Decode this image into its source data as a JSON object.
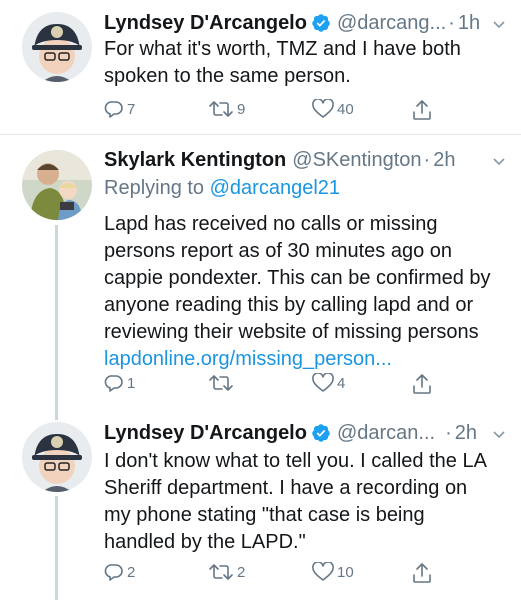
{
  "tweets": [
    {
      "name": "Lyndsey D'Arcangelo",
      "handle": "@darcang...",
      "time": "1h",
      "verified": true,
      "text": "For what it's worth, TMZ and I have both spoken to the same person.",
      "replies": "7",
      "retweets": "9",
      "likes": "40"
    },
    {
      "name": "Skylark Kentington",
      "handle": "@SKentington",
      "time": "2h",
      "verified": false,
      "replying_label": "Replying to",
      "replying_to": "@darcangel21",
      "text": "Lapd has received no calls or missing persons report as of 30 minutes ago on cappie pondexter. This can be confirmed by anyone reading this by calling lapd and or reviewing their website of missing persons",
      "link": "lapdonline.org/missing_person...",
      "replies": "1",
      "retweets": "",
      "likes": "4"
    },
    {
      "name": "Lyndsey D'Arcangelo",
      "handle": "@darcan...",
      "time": "2h",
      "verified": true,
      "text": "I don't know what to tell you. I called the LA Sheriff department. I have a recording on my phone stating \"that case is being handled by the LAPD.\"",
      "replies": "2",
      "retweets": "2",
      "likes": "10"
    }
  ],
  "separator": "·",
  "colors": {
    "accent": "#1b95e0",
    "muted": "#657786",
    "text": "#14171a",
    "divider": "#e1e8ed"
  },
  "icons": [
    "verified-badge-icon",
    "chevron-down-icon",
    "reply-icon",
    "retweet-icon",
    "like-icon",
    "share-icon"
  ]
}
